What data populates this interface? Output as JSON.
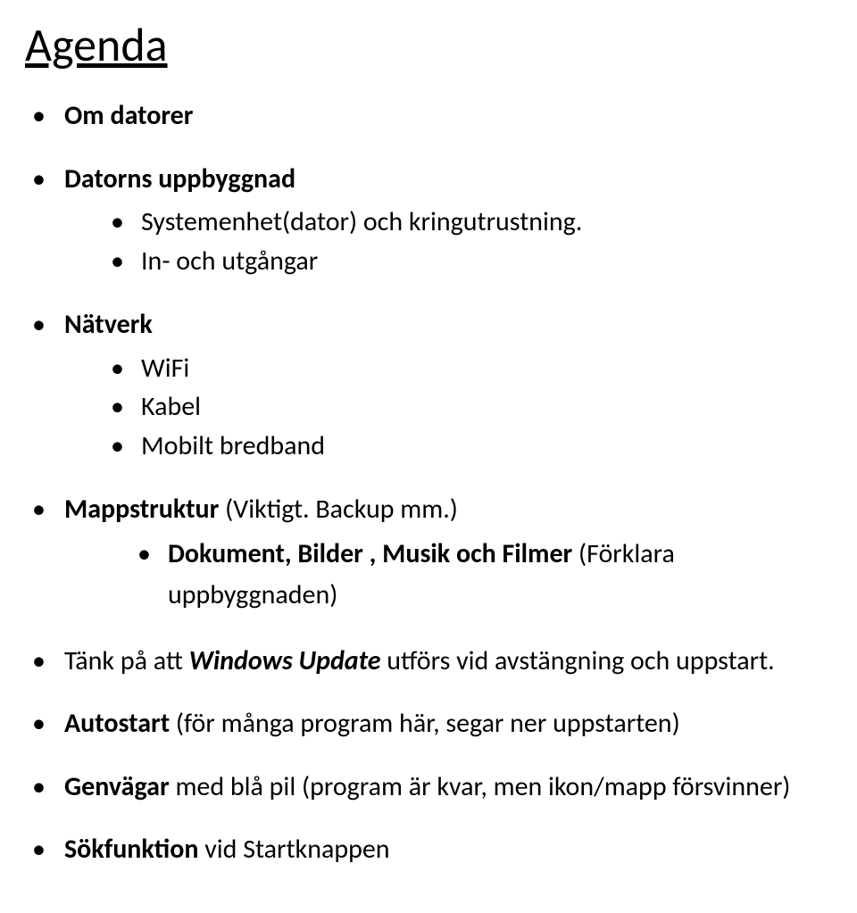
{
  "title": "Agenda",
  "items": {
    "om_datorer": "Om datorer",
    "datorns_uppbyggnad": "Datorns uppbyggnad",
    "systemenhet": "Systemenhet(dator) och kringutrustning.",
    "in_utgangar": "In- och utgångar",
    "natverk": "Nätverk",
    "wifi": "WiFi",
    "kabel": "Kabel",
    "mobilt": "Mobilt bredband",
    "mappstruktur_bold": "Mappstruktur ",
    "mappstruktur_rest": "(Viktigt. Backup mm.)",
    "dokument_bold": "Dokument, Bilder , Musik och Filmer ",
    "dokument_rest": "(Förklara uppbyggnaden)",
    "windows_pre": "Tänk på att ",
    "windows_bold": "Windows Update",
    "windows_post": " utförs vid avstängning och uppstart.",
    "autostart_bold": "Autostart ",
    "autostart_rest": "(för många program här, segar ner uppstarten)",
    "genvagar_bold": "Genvägar",
    "genvagar_rest": " med blå pil (program är kvar, men ikon/mapp försvinner)",
    "sokfunktion_bold": "Sökfunktion",
    "sokfunktion_rest": " vid Startknappen"
  }
}
